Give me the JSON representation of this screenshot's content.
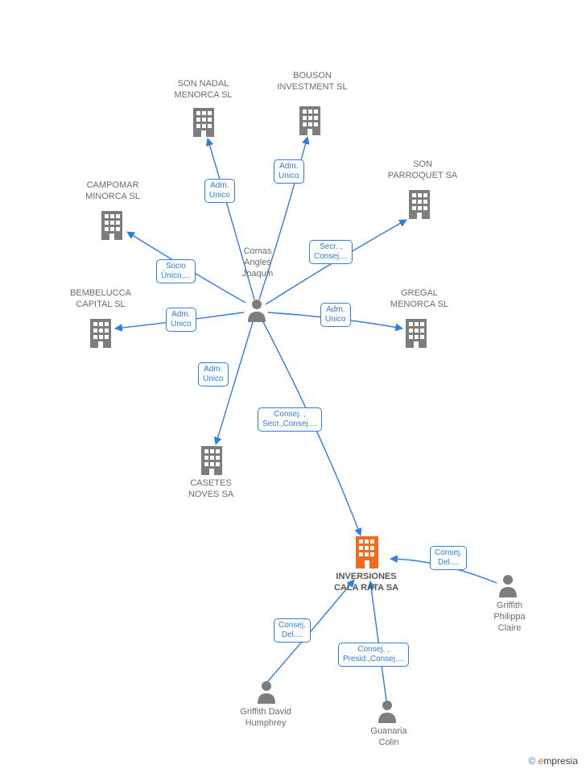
{
  "center_person": {
    "label": "Comas\nAngles\nJoaquin"
  },
  "focus_company": {
    "label": "INVERSIONES\nCALA RATA SA"
  },
  "companies": {
    "son_nadal": {
      "label": "SON NADAL\nMENORCA SL"
    },
    "bouson": {
      "label": "BOUSON\nINVESTMENT SL"
    },
    "son_parroquet": {
      "label": "SON\nPARROQUET SA"
    },
    "gregal": {
      "label": "GREGAL\nMENORCA SL"
    },
    "campomar": {
      "label": "CAMPOMAR\nMINORCA SL"
    },
    "bembelucca": {
      "label": "BEMBELUCCA\nCAPITAL SL"
    },
    "casetes": {
      "label": "CASETES\nNOVES SA"
    }
  },
  "people": {
    "griffith_david": {
      "label": "Griffith David\nHumphrey"
    },
    "guanaria_colin": {
      "label": "Guanaria\nColin"
    },
    "griffith_philippa": {
      "label": "Griffith\nPhilippa\nClaire"
    }
  },
  "edges": {
    "to_son_nadal": {
      "label": "Adm.\nUnico"
    },
    "to_bouson": {
      "label": "Adm.\nUnico"
    },
    "to_son_parroquet": {
      "label": "Secr. ,\nConsej...."
    },
    "to_gregal": {
      "label": "Adm.\nUnico"
    },
    "to_campomar": {
      "label": "Socio\nÚnico,..."
    },
    "to_bembelucca": {
      "label": "Adm.\nUnico"
    },
    "to_casetes": {
      "label": "Adm.\nUnico"
    },
    "to_inversiones": {
      "label": "Consej. ,\nSecr.,Consej...."
    },
    "philippa_to_inv": {
      "label": "Consej.\nDel...."
    },
    "david_to_inv": {
      "label": "Consej.\nDel...."
    },
    "colin_to_inv": {
      "label": "Consej. ,\nPresid.,Consej...."
    }
  },
  "footer": {
    "copyright": "©",
    "brand_e": "e",
    "brand_rest": "mpresia"
  },
  "colors": {
    "gray": "#7d7d7d",
    "orange": "#f26b1d",
    "blue": "#2f7de1",
    "label": "#6b6b6b"
  }
}
